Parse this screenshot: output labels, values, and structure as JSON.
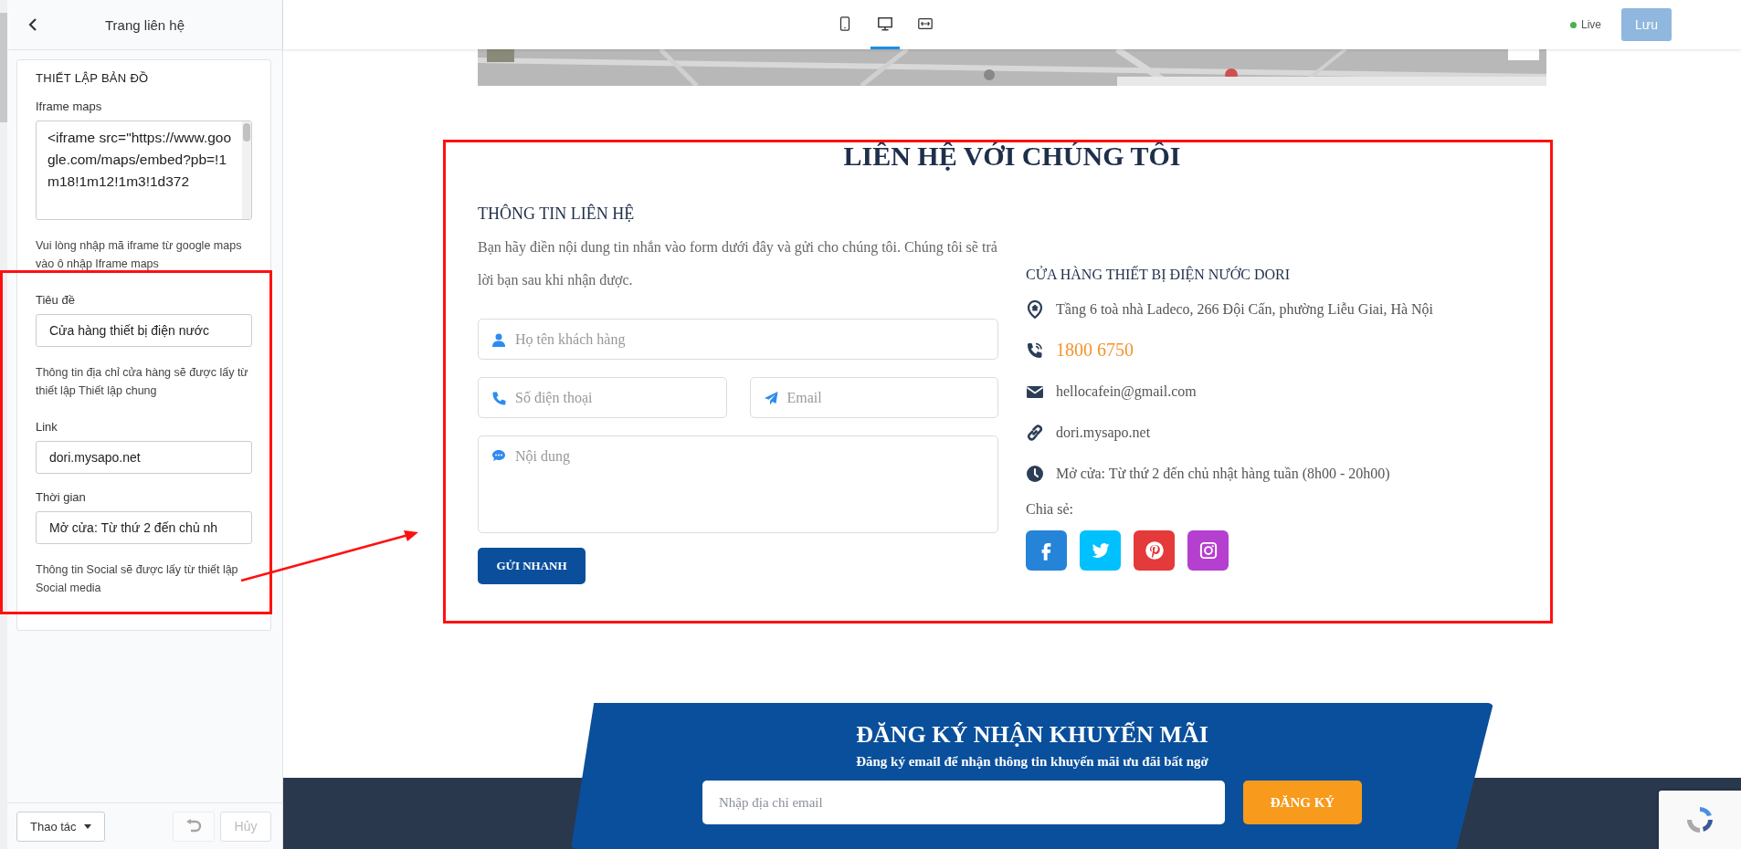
{
  "sidebar": {
    "title": "Trang liên hệ",
    "section_title": "THIẾT LẬP BẢN ĐỒ",
    "items": [
      {
        "kind": "textarea",
        "label": "Iframe maps",
        "value": "<iframe src=\"https://www.google.com/maps/embed?pb=!1m18!1m12!1m3!1d372"
      },
      {
        "kind": "note",
        "text": "Vui lòng nhập mã iframe từ google maps vào ô nhập Iframe maps"
      },
      {
        "kind": "input",
        "label": "Tiêu đề",
        "value": "Cửa hàng thiết bị điện nước"
      },
      {
        "kind": "note",
        "text": "Thông tin địa chỉ cửa hàng sẽ được lấy từ thiết lập Thiết lập chung"
      },
      {
        "kind": "input",
        "label": "Link",
        "value": "dori.mysapo.net"
      },
      {
        "kind": "input",
        "label": "Thời gian",
        "value": "Mở cửa: Từ thứ 2 đến chủ nh"
      },
      {
        "kind": "note",
        "text": "Thông tin Social sẽ được lấy từ thiết lập Social media"
      }
    ],
    "actions_button": "Thao tác",
    "undo": {
      "disabled": true
    },
    "cancel": {
      "label": "Hủy",
      "disabled": true
    }
  },
  "topbar": {
    "devices": [
      {
        "kind": "mobile",
        "selected": false
      },
      {
        "kind": "desktop",
        "selected": true
      },
      {
        "kind": "fit",
        "selected": false
      }
    ],
    "status": {
      "label": "Live",
      "color": "#4caf50"
    },
    "save": {
      "label": "Lưu",
      "disabled": true
    }
  },
  "contact": {
    "title": "LIÊN HỆ VỚI CHÚNG TÔI",
    "subtitle": "THÔNG TIN LIÊN HỆ",
    "description": "Bạn hãy điền nội dung tin nhắn vào form dưới đây và gửi cho chúng tôi. Chúng tôi sẽ trả lời bạn sau khi nhận được.",
    "fields": [
      {
        "kind": "name",
        "placeholder": "Họ tên khách hàng"
      },
      {
        "kind": "phone",
        "placeholder": "Số điện thoại"
      },
      {
        "kind": "email",
        "placeholder": "Email"
      },
      {
        "kind": "message",
        "placeholder": "Nội dung"
      }
    ],
    "submit": "GỬI NHANH",
    "store_name": "CỬA HÀNG THIẾT BỊ ĐIỆN NƯỚC DORI",
    "info": [
      {
        "kind": "address",
        "text": "Tầng 6 toà nhà Ladeco, 266 Đội Cấn, phường Liễu Giai, Hà Nội"
      },
      {
        "kind": "phone",
        "text": "1800 6750"
      },
      {
        "kind": "email",
        "text": "hellocafein@gmail.com"
      },
      {
        "kind": "link",
        "text": "dori.mysapo.net"
      },
      {
        "kind": "hours",
        "text": "Mở cửa: Từ thứ 2 đến chủ nhật hàng tuần (8h00 - 20h00)"
      }
    ],
    "share_label": "Chia sẻ:",
    "social": [
      {
        "kind": "facebook",
        "color": "#2684d8"
      },
      {
        "kind": "twitter",
        "color": "#00c0fd"
      },
      {
        "kind": "pinterest",
        "color": "#e53a3a"
      },
      {
        "kind": "instagram",
        "color": "#b53fcf"
      }
    ]
  },
  "promo": {
    "title": "ĐĂNG KÝ NHẬN KHUYẾN MÃI",
    "subtitle": "Đăng ký email để nhận thông tin khuyến mãi ưu đãi bất ngờ",
    "placeholder": "Nhập địa chỉ email",
    "button": "ĐĂNG KÝ"
  },
  "annotations": [
    {
      "kind": "sidebar-box"
    },
    {
      "kind": "content-box"
    },
    {
      "kind": "arrow"
    }
  ]
}
